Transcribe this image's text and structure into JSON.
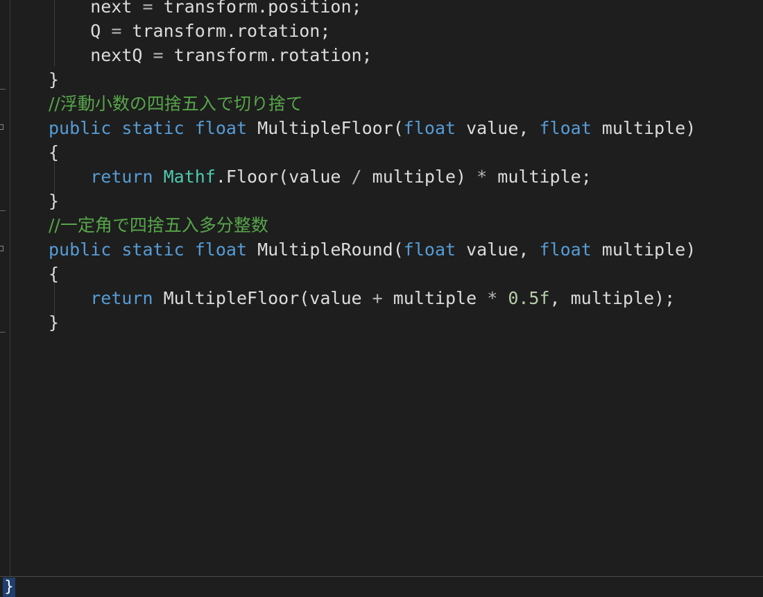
{
  "editor": {
    "lines": [
      {
        "tokens": [
          [
            "id",
            "    next "
          ],
          [
            "op",
            "="
          ],
          [
            "id",
            " transform.position;"
          ]
        ]
      },
      {
        "tokens": [
          [
            "id",
            "    Q "
          ],
          [
            "op",
            "="
          ],
          [
            "id",
            " transform.rotation;"
          ]
        ]
      },
      {
        "tokens": [
          [
            "id",
            "    nextQ "
          ],
          [
            "op",
            "="
          ],
          [
            "id",
            " transform.rotation;"
          ]
        ]
      },
      {
        "tokens": [
          [
            "id",
            "}"
          ]
        ]
      },
      {
        "tokens": [
          [
            "cmt",
            "//浮動小数の四捨五入で切り捨て"
          ]
        ]
      },
      {
        "tokens": [
          [
            "kw",
            "public"
          ],
          [
            "id",
            " "
          ],
          [
            "kw",
            "static"
          ],
          [
            "id",
            " "
          ],
          [
            "kw",
            "float"
          ],
          [
            "id",
            " MultipleFloor("
          ],
          [
            "kw",
            "float"
          ],
          [
            "id",
            " value, "
          ],
          [
            "kw",
            "float"
          ],
          [
            "id",
            " multiple)"
          ]
        ]
      },
      {
        "tokens": [
          [
            "id",
            "{"
          ]
        ]
      },
      {
        "tokens": [
          [
            "id",
            "    "
          ],
          [
            "kw",
            "return"
          ],
          [
            "id",
            " "
          ],
          [
            "type",
            "Mathf"
          ],
          [
            "id",
            ".Floor(value "
          ],
          [
            "op",
            "/"
          ],
          [
            "id",
            " multiple) "
          ],
          [
            "op",
            "*"
          ],
          [
            "id",
            " multiple;"
          ]
        ]
      },
      {
        "tokens": [
          [
            "id",
            "}"
          ]
        ]
      },
      {
        "tokens": [
          [
            "cmt",
            "//一定角で四捨五入多分整数"
          ]
        ]
      },
      {
        "tokens": [
          [
            "kw",
            "public"
          ],
          [
            "id",
            " "
          ],
          [
            "kw",
            "static"
          ],
          [
            "id",
            " "
          ],
          [
            "kw",
            "float"
          ],
          [
            "id",
            " MultipleRound("
          ],
          [
            "kw",
            "float"
          ],
          [
            "id",
            " value, "
          ],
          [
            "kw",
            "float"
          ],
          [
            "id",
            " multiple)"
          ]
        ]
      },
      {
        "tokens": [
          [
            "id",
            "{"
          ]
        ]
      },
      {
        "tokens": [
          [
            "id",
            "    "
          ],
          [
            "kw",
            "return"
          ],
          [
            "id",
            " MultipleFloor(value "
          ],
          [
            "op",
            "+"
          ],
          [
            "id",
            " multiple "
          ],
          [
            "op",
            "*"
          ],
          [
            "id",
            " "
          ],
          [
            "num",
            "0.5f"
          ],
          [
            "id",
            ", multiple);"
          ]
        ]
      },
      {
        "tokens": [
          [
            "id",
            "}"
          ]
        ]
      }
    ]
  },
  "status": {
    "closing_brace": "}"
  },
  "colors": {
    "background": "#1e1e1e",
    "keyword": "#569cd6",
    "type": "#4ec9b0",
    "number": "#b5cea8",
    "comment": "#57a64a",
    "identifier": "#dcdcdc"
  }
}
